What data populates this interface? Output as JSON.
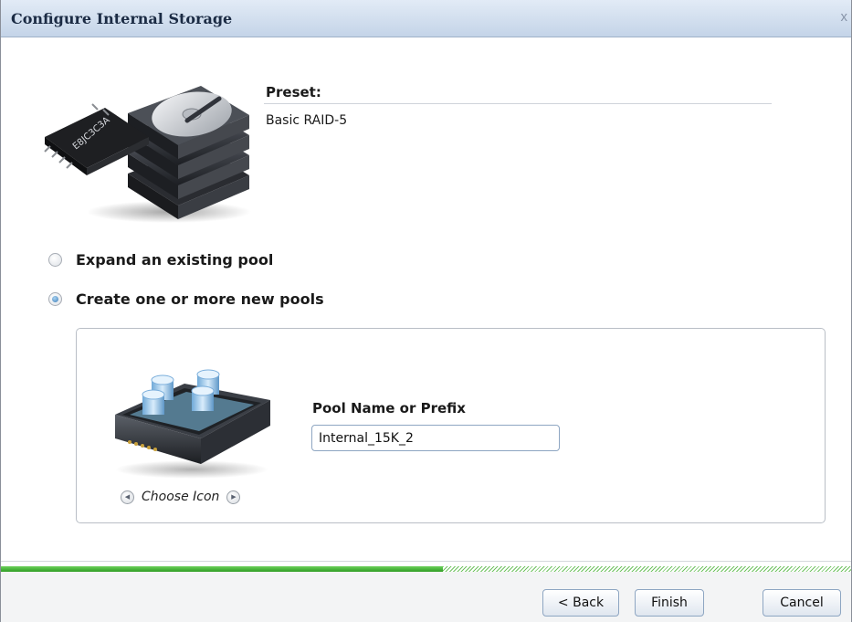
{
  "window": {
    "title": "Configure Internal Storage",
    "close_glyph": "x"
  },
  "preset": {
    "label": "Preset:",
    "value": "Basic RAID-5"
  },
  "options": [
    {
      "label": "Expand an existing pool",
      "checked": false
    },
    {
      "label": "Create one or more new pools",
      "checked": true
    }
  ],
  "pool": {
    "name_label": "Pool Name or Prefix",
    "name_value": "Internal_15K_2",
    "choose_icon_label": "Choose Icon",
    "chip_text": "E8JC3C3A"
  },
  "progress": {
    "fraction": 0.52,
    "colors": {
      "fill": "#2f9e25",
      "stripe": "#6fc260"
    }
  },
  "buttons": {
    "back": "< Back",
    "finish": "Finish",
    "cancel": "Cancel"
  },
  "icons": [
    "hard-drive-stack-icon",
    "storage-pool-icon",
    "prev-arrow-icon",
    "next-arrow-icon",
    "close-icon"
  ]
}
